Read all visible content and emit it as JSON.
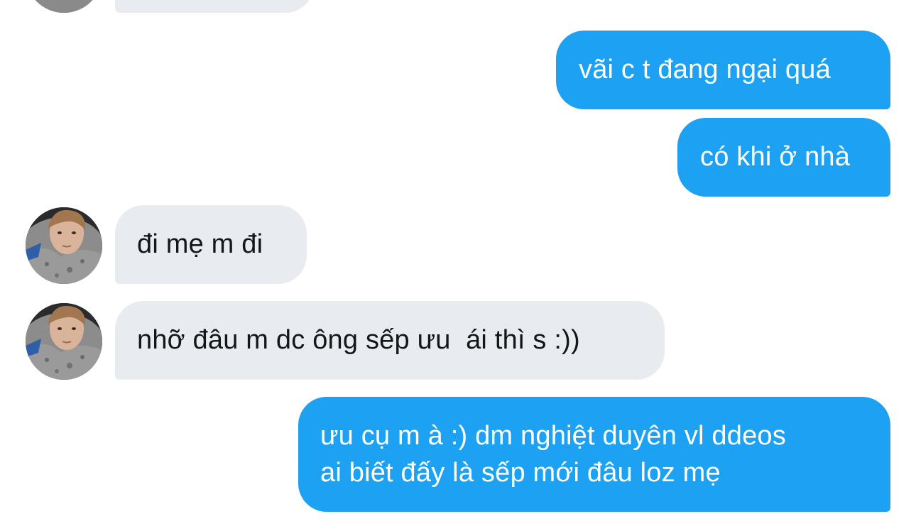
{
  "conversation": {
    "messages": [
      {
        "sender": "other",
        "text": ""
      },
      {
        "sender": "me",
        "text": "vãi c t đang ngại quá"
      },
      {
        "sender": "me",
        "text": "có khi ở nhà"
      },
      {
        "sender": "other",
        "text": "đi mẹ m đi",
        "avatar": "user-avatar-photo"
      },
      {
        "sender": "other",
        "text": "nhỡ đâu m dc ông sếp ưu  ái thì s :))",
        "avatar": "user-avatar-photo"
      },
      {
        "sender": "me",
        "lines": [
          "ưu cụ m à :) dm nghiệt duyên vl ddeos",
          "ai biết đấy là sếp mới đâu loz mẹ"
        ]
      }
    ]
  },
  "colors": {
    "sent_bubble": "#1da1f2",
    "received_bubble": "#e8ecf0",
    "sent_text": "#ffffff",
    "received_text": "#14171a",
    "background": "#ffffff"
  }
}
